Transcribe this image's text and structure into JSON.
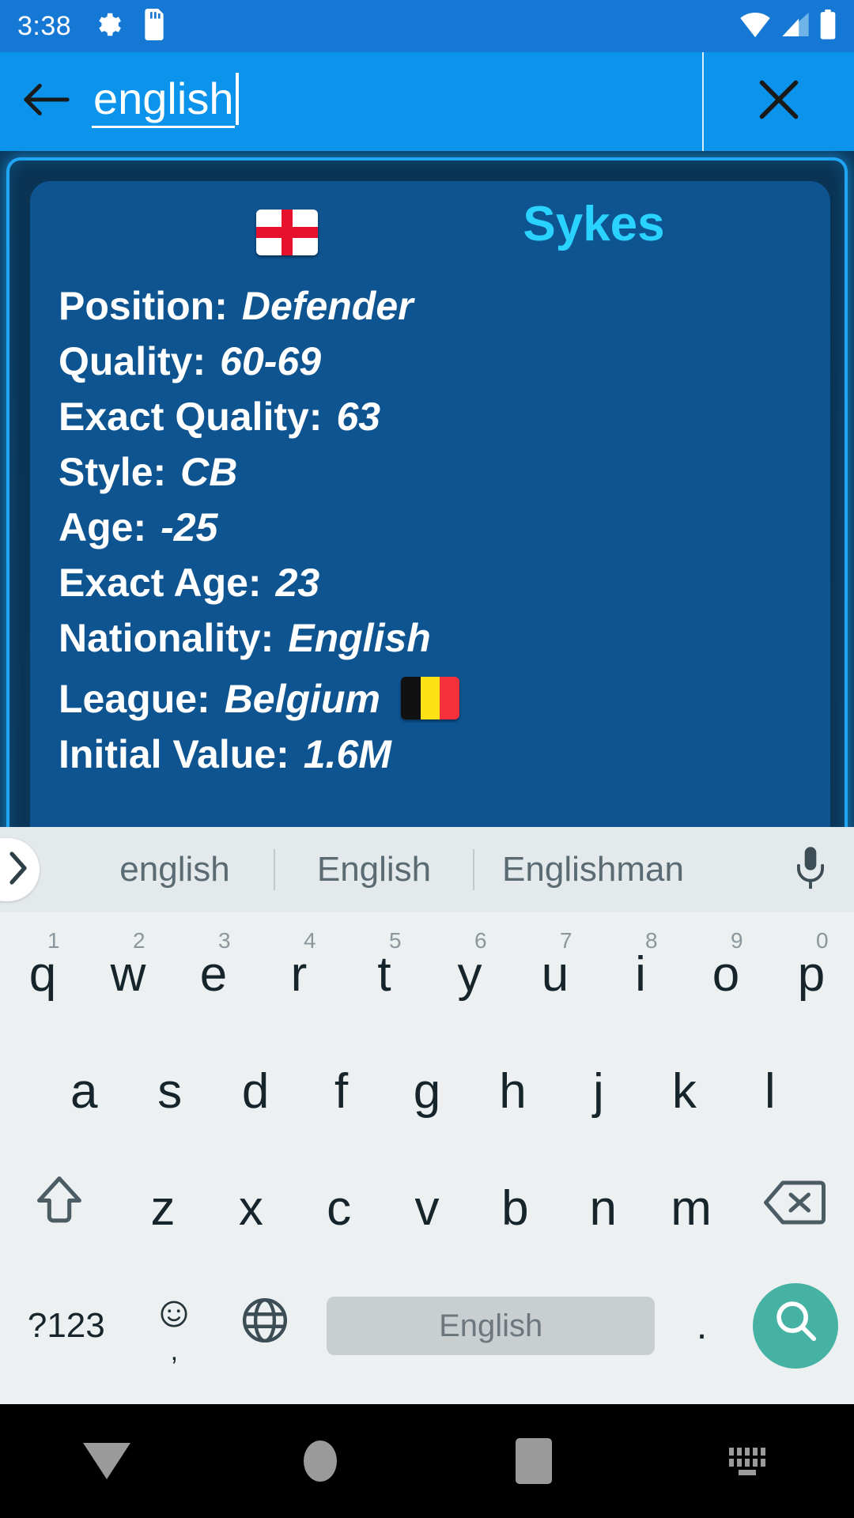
{
  "status_bar": {
    "time": "3:38",
    "left_icons": [
      "gear-icon",
      "sd-card-icon"
    ],
    "right_icons": [
      "wifi-icon",
      "cell-signal-icon",
      "battery-icon"
    ]
  },
  "search_bar": {
    "back_icon": "back-arrow-icon",
    "query": "english",
    "close_icon": "close-x-icon"
  },
  "player_card": {
    "nationality_flag": "england-flag",
    "name": "Sykes",
    "accent_color": "#2ad2ff",
    "card_bg": "#0e5490",
    "border_color": "#1fa6f5",
    "rows": [
      {
        "label": "Position:",
        "value": "Defender"
      },
      {
        "label": "Quality:",
        "value": "60-69"
      },
      {
        "label": "Exact Quality:",
        "value": "63"
      },
      {
        "label": "Style:",
        "value": "CB"
      },
      {
        "label": "Age:",
        "value": "-25"
      },
      {
        "label": "Exact Age:",
        "value": "23"
      },
      {
        "label": "Nationality:",
        "value": "English"
      },
      {
        "label": "League:",
        "value": "Belgium",
        "flag": "belgium-flag"
      },
      {
        "label": "Initial Value:",
        "value": "1.6M"
      }
    ]
  },
  "keyboard": {
    "suggestions": [
      "english",
      "English",
      "Englishman"
    ],
    "expand_icon": "chevron-right-icon",
    "mic_icon": "microphone-icon",
    "row1": [
      {
        "key": "q",
        "num": "1"
      },
      {
        "key": "w",
        "num": "2"
      },
      {
        "key": "e",
        "num": "3"
      },
      {
        "key": "r",
        "num": "4"
      },
      {
        "key": "t",
        "num": "5"
      },
      {
        "key": "y",
        "num": "6"
      },
      {
        "key": "u",
        "num": "7"
      },
      {
        "key": "i",
        "num": "8"
      },
      {
        "key": "o",
        "num": "9"
      },
      {
        "key": "p",
        "num": "0"
      }
    ],
    "row2": [
      "a",
      "s",
      "d",
      "f",
      "g",
      "h",
      "j",
      "k",
      "l"
    ],
    "row3": [
      "z",
      "x",
      "c",
      "v",
      "b",
      "n",
      "m"
    ],
    "shift_icon": "shift-up-arrow-icon",
    "backspace_icon": "backspace-icon",
    "symbols_label": "?123",
    "emoji_icon": "emoji-smiley-icon",
    "comma_label": ",",
    "globe_icon": "globe-language-icon",
    "space_label": "English",
    "period_label": ".",
    "search_icon": "search-magnifier-icon",
    "search_key_color": "#45b2a4"
  },
  "nav_bar": {
    "back_icon": "nav-back-triangle-icon",
    "home_icon": "nav-home-circle-icon",
    "recents_icon": "nav-recents-square-icon",
    "keyboard_icon": "nav-keyboard-toggle-icon"
  }
}
